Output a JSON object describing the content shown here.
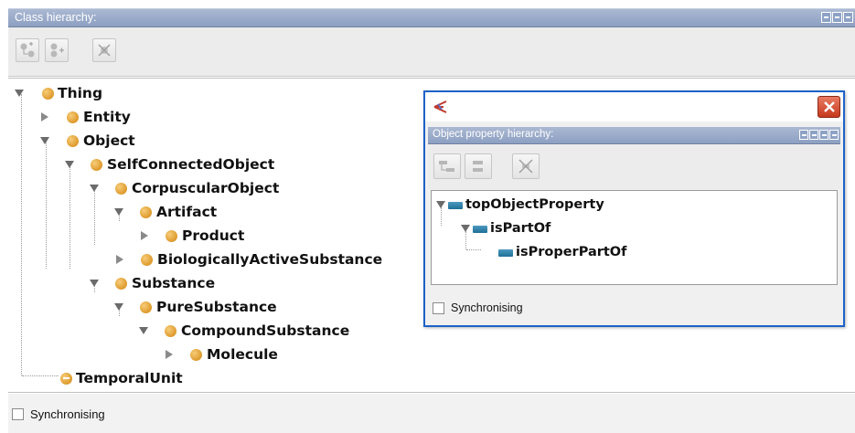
{
  "class_hierarchy": {
    "title": "Class hierarchy:",
    "toolbar": {
      "add_subclass_icon": "add-subclass-icon",
      "add_sibling_icon": "add-sibling-icon",
      "delete_icon": "delete-class-icon"
    },
    "tree": [
      {
        "label": "Thing",
        "expanded": true
      },
      {
        "label": "Entity",
        "expanded": false
      },
      {
        "label": "Object",
        "expanded": true
      },
      {
        "label": "SelfConnectedObject",
        "expanded": true
      },
      {
        "label": "CorpuscularObject",
        "expanded": true
      },
      {
        "label": "Artifact",
        "expanded": true
      },
      {
        "label": "Product",
        "expanded": false
      },
      {
        "label": "BiologicallyActiveSubstance",
        "expanded": false
      },
      {
        "label": "Substance",
        "expanded": true
      },
      {
        "label": "PureSubstance",
        "expanded": true
      },
      {
        "label": "CompoundSubstance",
        "expanded": true
      },
      {
        "label": "Molecule",
        "expanded": false
      },
      {
        "label": "TemporalUnit",
        "expanded": false
      }
    ],
    "synchronising_label": "Synchronising",
    "synchronising_checked": false
  },
  "dialog": {
    "close_icon": "close-icon",
    "app_icon": "protege-icon",
    "panel_title": "Object property hierarchy:",
    "tree": [
      {
        "label": "topObjectProperty",
        "expanded": true
      },
      {
        "label": "isPartOf",
        "expanded": true
      },
      {
        "label": "isProperPartOf",
        "expanded": false
      }
    ],
    "synchronising_label": "Synchronising",
    "synchronising_checked": false
  },
  "colors": {
    "title_bar": "#8da0c2",
    "class_dot": "#de9a2c",
    "property_bar": "#1e6f96",
    "close_button": "#c6391d",
    "dialog_border": "#1d62c9"
  }
}
